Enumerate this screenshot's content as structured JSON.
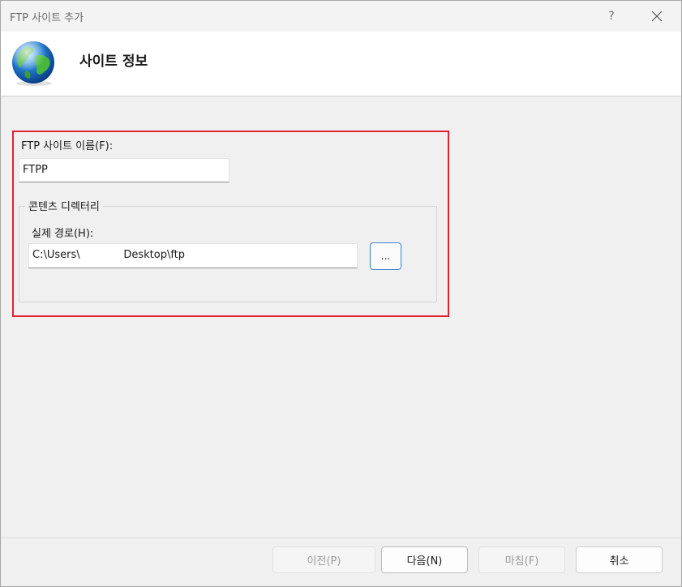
{
  "window": {
    "title": "FTP 사이트 추가",
    "help_label": "?"
  },
  "header": {
    "title": "사이트 정보",
    "icon": "globe-icon"
  },
  "form": {
    "site_name_label": "FTP 사이트 이름(F):",
    "site_name_value": "FTPP",
    "content_dir_legend": "콘텐츠 디렉터리",
    "physical_path_label": "실제 경로(H):",
    "physical_path_value": "C:\\Users\\             Desktop\\ftp",
    "browse_label": "..."
  },
  "footer": {
    "prev_label": "이전(P)",
    "next_label": "다음(N)",
    "finish_label": "마침(F)",
    "cancel_label": "취소"
  },
  "colors": {
    "highlight": "#e0242f",
    "accent": "#3d7fd0"
  }
}
